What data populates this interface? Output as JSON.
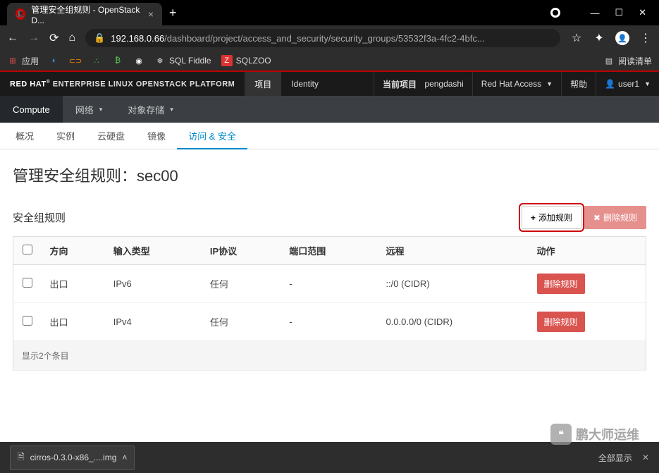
{
  "browser": {
    "tab_title": "管理安全组规则 - OpenStack D...",
    "url_host": "192.168.0.66",
    "url_path": "/dashboard/project/access_and_security/security_groups/53532f3a-4fc2-4bfc...",
    "bookmarks_label": "应用",
    "bm_sqlfiddle": "SQL Fiddle",
    "bm_sqlzoo": "SQLZOO",
    "reading_list": "阅读清单"
  },
  "header": {
    "brand_prefix": "RED HAT",
    "brand_suffix": " ENTERPRISE LINUX OPENSTACK PLATFORM",
    "nav_project": "项目",
    "nav_identity": "Identity",
    "current_project_label": "当前项目",
    "current_project": "pengdashi",
    "access": "Red Hat Access",
    "help": "帮助",
    "user": "user1"
  },
  "subnav": {
    "compute": "Compute",
    "network": "网络",
    "object": "对象存储"
  },
  "tabs": {
    "overview": "概况",
    "instances": "实例",
    "volumes": "云硬盘",
    "images": "镜像",
    "access": "访问 & 安全"
  },
  "page": {
    "title_prefix": "管理安全组规则：",
    "group_name": "sec00",
    "section_title": "安全组规则",
    "add_btn": "添加规则",
    "del_btn": "删除规则"
  },
  "table": {
    "h_direction": "方向",
    "h_ethertype": "输入类型",
    "h_protocol": "IP协议",
    "h_portrange": "端口范围",
    "h_remote": "远程",
    "h_action": "动作",
    "rows": [
      {
        "direction": "出口",
        "ethertype": "IPv6",
        "protocol": "任何",
        "portrange": "-",
        "remote": "::/0 (CIDR)",
        "del": "删除规则"
      },
      {
        "direction": "出口",
        "ethertype": "IPv4",
        "protocol": "任何",
        "portrange": "-",
        "remote": "0.0.0.0/0 (CIDR)",
        "del": "删除规则"
      }
    ],
    "footer": "显示2个条目"
  },
  "download": {
    "file": "cirros-0.3.0-x86_....img",
    "show_all": "全部显示"
  },
  "watermark": "鹏大师运维"
}
